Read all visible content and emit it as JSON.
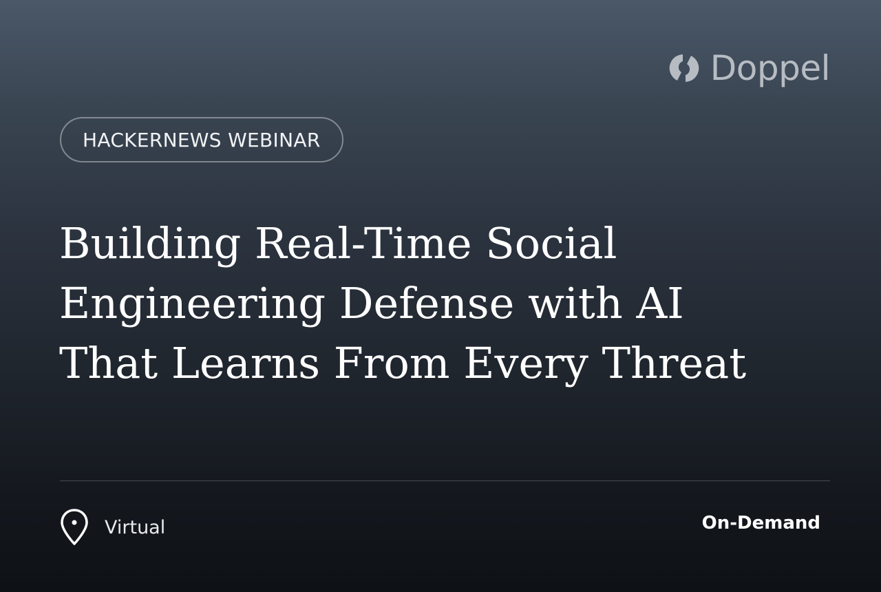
{
  "brand": {
    "name": "Doppel",
    "color": "#b7bcc3",
    "icon": "doppel-logo-icon"
  },
  "badge": {
    "label": "HACKERNEWS WEBINAR"
  },
  "title": {
    "lines": [
      "Building Real-Time Social",
      "Engineering Defense with AI",
      "That Learns From Every Threat"
    ]
  },
  "footer": {
    "location_icon": "location-pin-icon",
    "location": "Virtual",
    "availability": "On-Demand"
  }
}
